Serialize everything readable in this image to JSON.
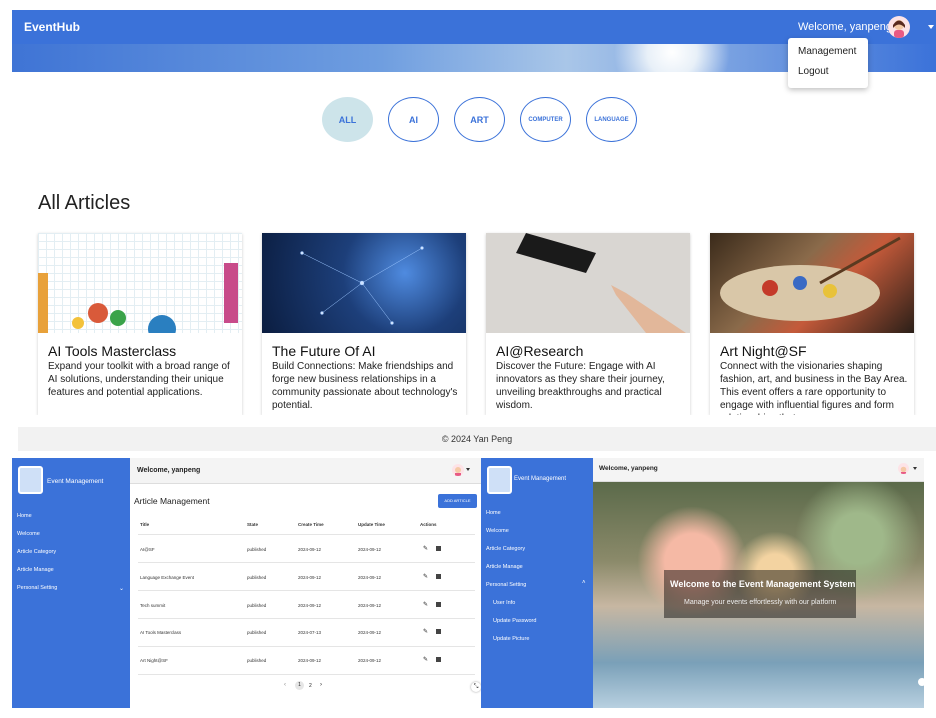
{
  "top": {
    "brand": "EventHub",
    "welcome": "Welcome, yanpeng",
    "menu": [
      "Management",
      "Logout"
    ],
    "categories": [
      "ALL",
      "AI",
      "ART",
      "COMPUTER",
      "LANGUAGE"
    ],
    "section_title": "All Articles",
    "articles": [
      {
        "title": "AI Tools Masterclass",
        "desc": "Expand your toolkit with a broad range of AI solutions, understanding their unique features and potential applications."
      },
      {
        "title": "The Future Of AI",
        "desc": "Build Connections: Make friendships and forge new business relationships in a community passionate about technology's potential."
      },
      {
        "title": "AI@Research",
        "desc": "Discover the Future: Engage with AI innovators as they share their journey, unveiling breakthroughs and practical wisdom."
      },
      {
        "title": "Art Night@SF",
        "desc": "Connect with the visionaries shaping fashion, art, and business in the Bay Area. This event offers a rare opportunity to engage with influential figures and form relationships that"
      }
    ],
    "footer": "© 2024 Yan Peng"
  },
  "admin": {
    "app_title": "Event Management",
    "welcome": "Welcome, yanpeng",
    "sidebar": [
      "Home",
      "Welcome",
      "Article Category",
      "Article Manage",
      "Personal Setting"
    ],
    "page_title": "Article Management",
    "add_button": "ADD ARTICLE",
    "columns": [
      "Title",
      "State",
      "Create Time",
      "Update Time",
      "Actions"
    ],
    "rows": [
      {
        "title": "AI@SF",
        "state": "published",
        "created": "2024-09-12",
        "updated": "2024-09-12"
      },
      {
        "title": "Language Exchange Event",
        "state": "published",
        "created": "2024-09-12",
        "updated": "2024-09-12"
      },
      {
        "title": "Tech summit",
        "state": "published",
        "created": "2024-09-12",
        "updated": "2024-09-12"
      },
      {
        "title": "AI Tools Masterclass",
        "state": "published",
        "created": "2024-07-13",
        "updated": "2024-09-12"
      },
      {
        "title": "Art Night@SF",
        "state": "published",
        "created": "2024-09-12",
        "updated": "2024-09-12"
      }
    ],
    "pagination": {
      "prev": "‹",
      "pages": [
        "1",
        "2"
      ],
      "next": "›",
      "current": "1"
    }
  },
  "welcome_page": {
    "app_title": "Event Management",
    "welcome": "Welcome, yanpeng",
    "sidebar": [
      "Home",
      "Welcome",
      "Article Category",
      "Article Manage",
      "Personal Setting",
      "User Info",
      "Update Password",
      "Update Picture"
    ],
    "hero_title": "Welcome to the Event Management System",
    "hero_subtitle": "Manage your events effortlessly with our platform"
  },
  "colors": {
    "primary": "#3b72d9",
    "active_pill": "#cde4ea"
  }
}
